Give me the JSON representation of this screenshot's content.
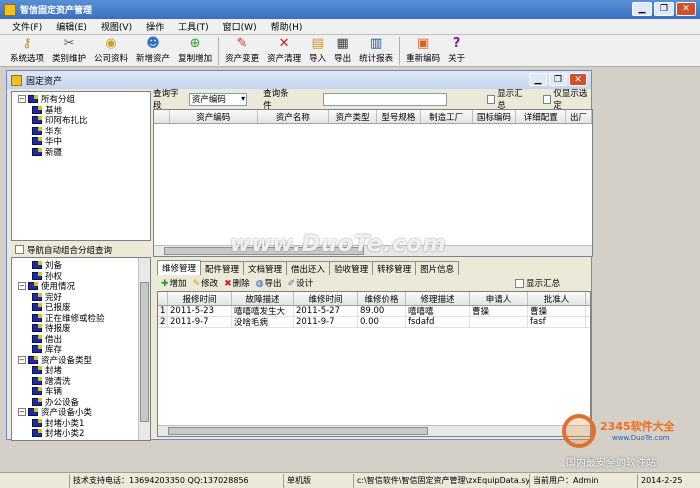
{
  "window": {
    "title": "智信固定资产管理"
  },
  "menu": [
    "文件(F)",
    "编辑(E)",
    "视图(V)",
    "操作",
    "工具(T)",
    "窗口(W)",
    "帮助(H)"
  ],
  "toolbar": [
    {
      "label": "系统选项",
      "icon": "key-icon"
    },
    {
      "label": "类别维护",
      "icon": "tools-icon"
    },
    {
      "label": "公司资料",
      "icon": "coins-icon"
    },
    {
      "label": "新增资产",
      "icon": "add-user-icon"
    },
    {
      "label": "复制增加",
      "icon": "copy-add-icon"
    },
    {
      "label": "资产变更",
      "icon": "pencil-icon"
    },
    {
      "label": "资产清理",
      "icon": "delete-x-icon"
    },
    {
      "label": "导入",
      "icon": "import-icon"
    },
    {
      "label": "导出",
      "icon": "printer-icon"
    },
    {
      "label": "统计报表",
      "icon": "chart-icon"
    },
    {
      "label": "重新编码",
      "icon": "recode-icon"
    },
    {
      "label": "关于",
      "icon": "help-icon"
    }
  ],
  "mdi": {
    "title": "固定资产"
  },
  "tree_top": [
    {
      "label": "所有分组",
      "level": 0,
      "expander": "−"
    },
    {
      "label": "基地",
      "level": 1
    },
    {
      "label": "印阿布扎比",
      "level": 1
    },
    {
      "label": "华东",
      "level": 1
    },
    {
      "label": "华中",
      "level": 1
    },
    {
      "label": "新疆",
      "level": 1
    }
  ],
  "group_header": "导航自动组合分组查询",
  "tree_bottom": [
    {
      "label": "刘备",
      "level": 1
    },
    {
      "label": "孙权",
      "level": 1
    },
    {
      "label": "使用情况",
      "level": 0,
      "expander": "−"
    },
    {
      "label": "完好",
      "level": 1
    },
    {
      "label": "已报废",
      "level": 1
    },
    {
      "label": "正在维修或检验",
      "level": 1
    },
    {
      "label": "待报废",
      "level": 1
    },
    {
      "label": "借出",
      "level": 1
    },
    {
      "label": "库存",
      "level": 1
    },
    {
      "label": "资产设备类型",
      "level": 0,
      "expander": "−"
    },
    {
      "label": "封堵",
      "level": 1
    },
    {
      "label": "蹭清洗",
      "level": 1
    },
    {
      "label": "车辆",
      "level": 1
    },
    {
      "label": "办公设备",
      "level": 1
    },
    {
      "label": "资产设备小类",
      "level": 0,
      "expander": "−"
    },
    {
      "label": "封堵小类1",
      "level": 1
    },
    {
      "label": "封堵小类2",
      "level": 1
    }
  ],
  "query": {
    "field_label": "查询字段",
    "field_value": "资产编码",
    "condition_label": "查询条件",
    "condition_value": "",
    "show_summary": "显示汇总",
    "show_selected": "仅显示选定"
  },
  "asset_grid": {
    "columns": [
      "资产编码",
      "资产名称",
      "资产类型",
      "型号规格",
      "制造工厂",
      "国标编码",
      "详细配置",
      "出厂"
    ]
  },
  "tabs": [
    "维修管理",
    "配件管理",
    "文档管理",
    "借出还入",
    "验收管理",
    "转移管理",
    "图片信息"
  ],
  "active_tab": "维修管理",
  "sub_toolbar": {
    "add": "增加",
    "edit": "修改",
    "delete": "删除",
    "export": "导出",
    "design": "设计",
    "show_summary": "显示汇总"
  },
  "repair_grid": {
    "columns": [
      "报修时间",
      "故障描述",
      "维修时间",
      "维修价格",
      "修理描述",
      "申请人",
      "批准人"
    ],
    "rows": [
      {
        "no": "1",
        "cells": [
          "2011-5-23",
          "嘻嘻嘻发生大",
          "2011-5-27",
          "89.00",
          "嘻嘻嘻",
          "曹操",
          "曹操"
        ]
      },
      {
        "no": "2",
        "cells": [
          "2011-9-7",
          "没啥毛病",
          "2011-9-7",
          "0.00",
          "fsdafd",
          "",
          "fasf"
        ]
      }
    ]
  },
  "status": {
    "support": "技术支持电话：13694203350 QQ:137028856",
    "edition": "单机版",
    "path": "c:\\智信软件\\智信固定资产管理\\zxEquipData.sys",
    "user": "当前用户：Admin",
    "date": "2014-2-25"
  },
  "watermark": "www.DuoTe.com",
  "logo": {
    "brand": "2345软件大全",
    "url": "www.DuoTe.com",
    "slogan": "国内最安全的软件站"
  },
  "colors": {
    "title_blue": "#3a6fc0",
    "tree_folder": "#1a2ca0",
    "logo_orange": "#f07020"
  }
}
